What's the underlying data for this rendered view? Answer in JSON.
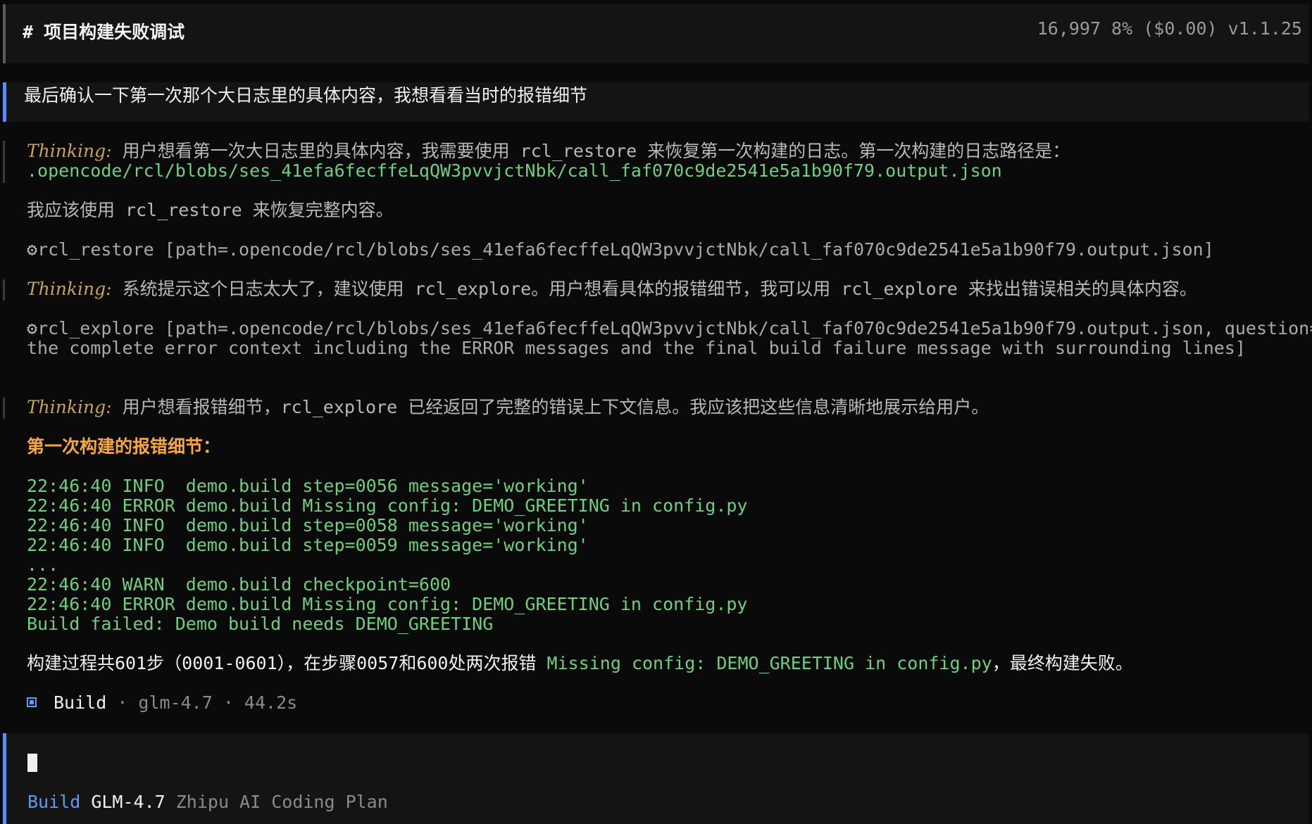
{
  "header": {
    "title": "# 项目构建失败调试",
    "stats": "16,997  8% ($0.00) v1.1.25"
  },
  "user_prompt": "最后确认一下第一次那个大日志里的具体内容，我想看看当时的报错细节",
  "messages": {
    "thinking_label": "Thinking:",
    "thinking1_text": " 用户想看第一次大日志里的具体内容，我需要使用 rcl_restore 来恢复第一次构建的日志。第一次构建的日志路径是：",
    "thinking1_path": ".opencode/rcl/blobs/ses_41efa6fecffeLqQW3pvvjctNbk/call_faf070c9de2541e5a1b90f79.output.json",
    "assistant1": "我应该使用 rcl_restore 来恢复完整内容。",
    "tool1_icon": "gear-icon",
    "tool1": "rcl_restore [path=.opencode/rcl/blobs/ses_41efa6fecffeLqQW3pvvjctNbk/call_faf070c9de2541e5a1b90f79.output.json]",
    "thinking2_text": " 系统提示这个日志太大了，建议使用 rcl_explore。用户想看具体的报错细节，我可以用 rcl_explore 来找出错误相关的具体内容。",
    "tool2_line1": "rcl_explore [path=.opencode/rcl/blobs/ses_41efa6fecffeLqQW3pvvjctNbk/call_faf070c9de2541e5a1b90f79.output.json, question=Show",
    "tool2_line2": "the complete error context including the ERROR messages and the final build failure message with surrounding lines]",
    "thinking3_text": " 用户想看报错细节，rcl_explore 已经返回了完整的错误上下文信息。我应该把这些信息清晰地展示给用户。",
    "section_heading": "第一次构建的报错细节：",
    "log_lines": [
      "22:46:40 INFO  demo.build step=0056 message='working'",
      "22:46:40 ERROR demo.build Missing config: DEMO_GREETING in config.py",
      "22:46:40 INFO  demo.build step=0058 message='working'",
      "22:46:40 INFO  demo.build step=0059 message='working'",
      "...",
      "22:46:40 WARN  demo.build checkpoint=600",
      "22:46:40 ERROR demo.build Missing config: DEMO_GREETING in config.py",
      "Build failed: Demo build needs DEMO_GREETING"
    ],
    "summary_prefix": "构建过程共601步（0001-0601），在步骤0057和600处两次报错 ",
    "summary_code": "Missing config: DEMO_GREETING in config.py",
    "summary_suffix": "，最终构建失败。",
    "build_meta_label": "Build",
    "build_meta_rest": " · glm-4.7 · 44.2s"
  },
  "footer": {
    "mode": "Build",
    "model": "GLM-4.7",
    "provider": "Zhipu AI Coding Plan"
  }
}
